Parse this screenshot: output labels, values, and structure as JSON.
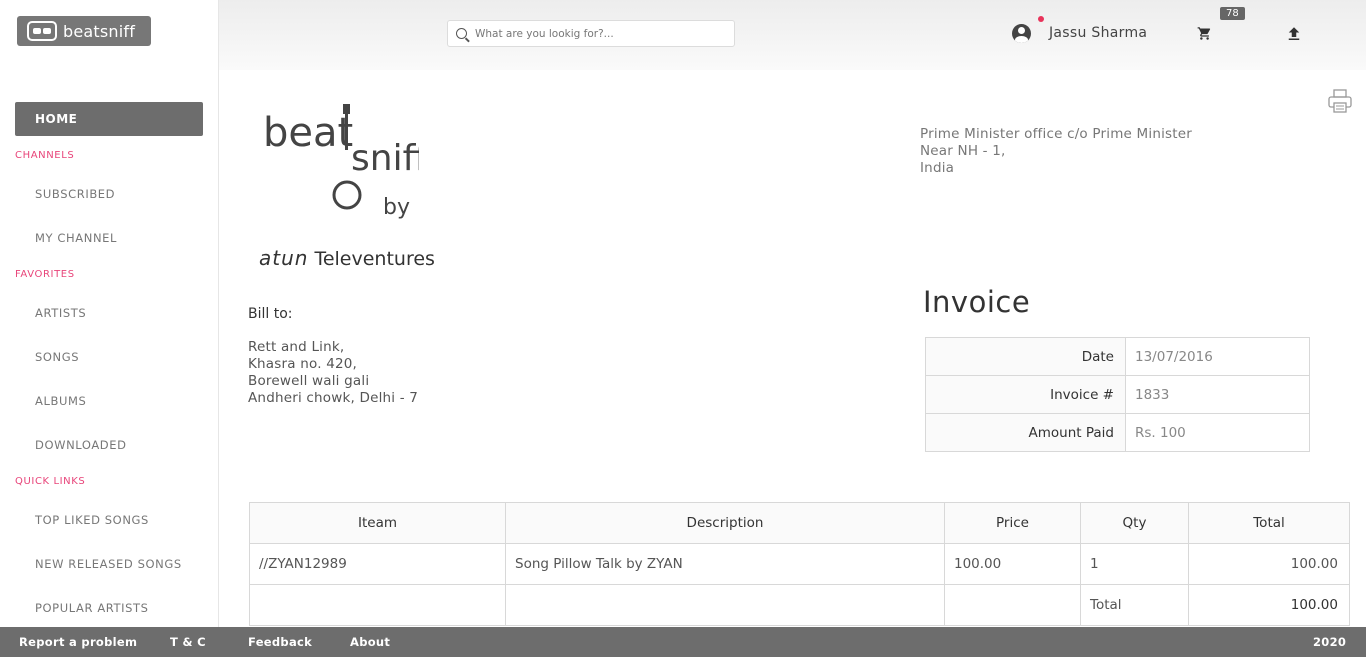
{
  "header": {
    "logo_text": "beatsniff",
    "search_placeholder": "What are you lookig for?...",
    "user_name": "Jassu Sharma",
    "cart_count": "78"
  },
  "sidebar": {
    "home": "HOME",
    "sections": [
      {
        "title": "CHANNELS",
        "items": [
          "SUBSCRIBED",
          "MY CHANNEL"
        ]
      },
      {
        "title": "FAVORITES",
        "items": [
          "ARTISTS",
          "SONGS",
          "ALBUMS",
          "DOWNLOADED"
        ]
      },
      {
        "title": "QUICK LINKS",
        "items": [
          "TOP LIKED SONGS",
          "NEW RELEASED SONGS",
          "POPULAR ARTISTS"
        ]
      }
    ]
  },
  "invoice": {
    "brand_word_1": "beat",
    "brand_word_2": "sniff",
    "brand_by": "by",
    "brand_company_prefix": "atun",
    "brand_company": "Televentures",
    "seller_address": [
      "Prime Minister office c/o Prime Minister",
      "Near NH - 1,",
      "India"
    ],
    "bill_label": "Bill to:",
    "bill_address": [
      "Rett and Link,",
      "Khasra no. 420,",
      "Borewell wali gali",
      "Andheri chowk, Delhi - 7"
    ],
    "title": "Invoice",
    "meta": [
      {
        "label": "Date",
        "value": "13/07/2016"
      },
      {
        "label": "Invoice #",
        "value": "1833"
      },
      {
        "label": "Amount Paid",
        "value": "Rs. 100"
      }
    ],
    "columns": [
      "Iteam",
      "Description",
      "Price",
      "Qty",
      "Total"
    ],
    "rows": [
      {
        "item": "//ZYAN12989",
        "description": "Song Pillow Talk by ZYAN",
        "price": "100.00",
        "qty": "1",
        "total": "100.00"
      }
    ],
    "total_label": "Total",
    "total_value": "100.00"
  },
  "footer": {
    "links": [
      "Report a problem",
      "T & C",
      "Feedback",
      "About"
    ],
    "year": "2020"
  }
}
